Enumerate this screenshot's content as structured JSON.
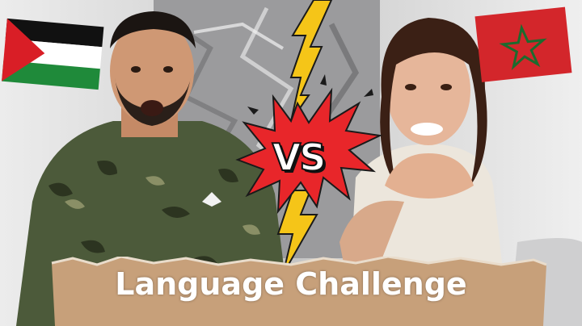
{
  "thumbnail": {
    "vs_label": "VS",
    "caption": "Language Challenge",
    "left_flag": "palestine-flag",
    "right_flag": "morocco-flag",
    "colors": {
      "flag_black": "#111111",
      "flag_white": "#ffffff",
      "flag_green": "#1f8a3a",
      "flag_red": "#d91e26",
      "morocco_red": "#d3262b",
      "morocco_star": "#1c6b2e",
      "lightning": "#f5c518",
      "burst": "#e8262a",
      "paper": "#c7a07a"
    }
  }
}
